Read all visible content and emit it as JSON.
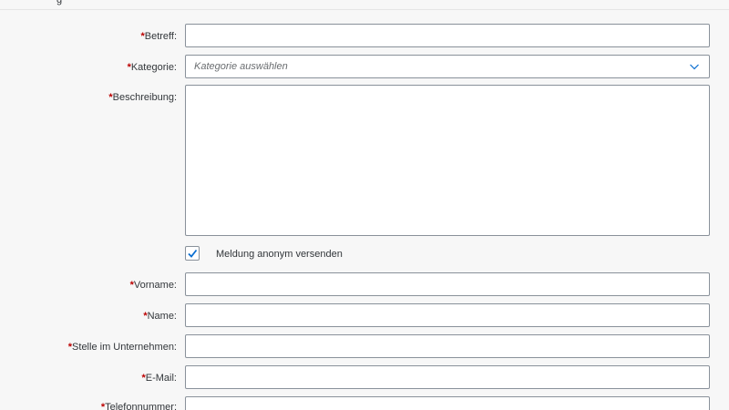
{
  "header": {
    "partial_title_glyph": "g"
  },
  "form": {
    "required_marker": "*",
    "betreff": {
      "label": "Betreff:",
      "value": ""
    },
    "kategorie": {
      "label": "Kategorie:",
      "placeholder": "Kategorie auswählen"
    },
    "beschreibung": {
      "label": "Beschreibung:",
      "value": ""
    },
    "anonym": {
      "label": "Meldung anonym versenden",
      "checked": true
    },
    "vorname": {
      "label": "Vorname:",
      "value": ""
    },
    "name": {
      "label": "Name:",
      "value": ""
    },
    "stelle": {
      "label": "Stelle im Unternehmen:",
      "value": ""
    },
    "email": {
      "label": "E-Mail:",
      "value": ""
    },
    "telefon": {
      "label": "Telefonnummer:",
      "value": ""
    }
  },
  "icons": {
    "dropdown": "chevron-down-icon",
    "checkbox": "checkmark-icon"
  },
  "colors": {
    "required": "#bb0000",
    "checkmark": "#0a6ed1",
    "border": "#89919a",
    "background": "#f7f7f7"
  }
}
